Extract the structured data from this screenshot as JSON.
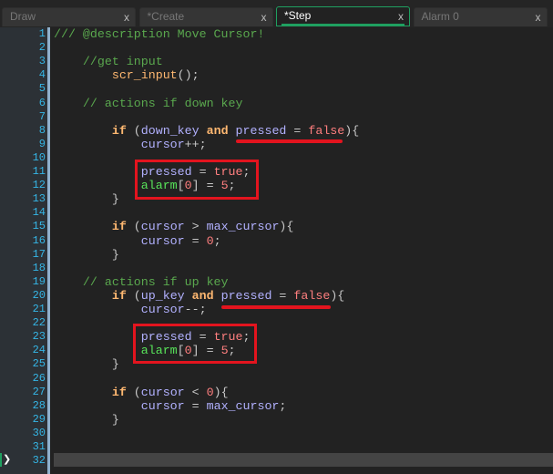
{
  "tabs": [
    {
      "label": "Draw",
      "close": "x",
      "active": false
    },
    {
      "label": "*Create",
      "close": "x",
      "active": false
    },
    {
      "label": "*Step",
      "close": "x",
      "active": true
    },
    {
      "label": "Alarm 0",
      "close": "x",
      "active": false
    }
  ],
  "colors": {
    "accent": "#1fa060",
    "annotation": "#e3141e",
    "comment": "#5aa84e",
    "keyword": "#ffb871",
    "variable": "#b2b1ff",
    "literal": "#ff7f7f",
    "builtin": "#58e55a"
  },
  "editor": {
    "current_line": 32,
    "lines": [
      [
        [
          "comment",
          "/// @description Move Cursor!"
        ]
      ],
      [],
      [
        [
          "comment",
          "    //get input"
        ]
      ],
      [
        [
          "punc",
          "        "
        ],
        [
          "fn",
          "scr_input"
        ],
        [
          "punc",
          "();"
        ]
      ],
      [],
      [
        [
          "comment",
          "    // actions if down key"
        ]
      ],
      [],
      [
        [
          "punc",
          "        "
        ],
        [
          "kw",
          "if"
        ],
        [
          "punc",
          " ("
        ],
        [
          "var",
          "down_key"
        ],
        [
          "punc",
          " "
        ],
        [
          "kw",
          "and"
        ],
        [
          "punc",
          " "
        ],
        [
          "var",
          "pressed"
        ],
        [
          "punc",
          " = "
        ],
        [
          "lit",
          "false"
        ],
        [
          "punc",
          "){"
        ]
      ],
      [
        [
          "punc",
          "            "
        ],
        [
          "var",
          "cursor"
        ],
        [
          "punc",
          "++;"
        ]
      ],
      [],
      [
        [
          "punc",
          "            "
        ],
        [
          "var",
          "pressed"
        ],
        [
          "punc",
          " = "
        ],
        [
          "lit",
          "true"
        ],
        [
          "punc",
          ";"
        ]
      ],
      [
        [
          "punc",
          "            "
        ],
        [
          "builtin",
          "alarm"
        ],
        [
          "punc",
          "["
        ],
        [
          "lit",
          "0"
        ],
        [
          "punc",
          "] = "
        ],
        [
          "lit",
          "5"
        ],
        [
          "punc",
          ";"
        ]
      ],
      [
        [
          "punc",
          "        }"
        ]
      ],
      [],
      [
        [
          "punc",
          "        "
        ],
        [
          "kw",
          "if"
        ],
        [
          "punc",
          " ("
        ],
        [
          "var",
          "cursor"
        ],
        [
          "punc",
          " > "
        ],
        [
          "var",
          "max_cursor"
        ],
        [
          "punc",
          "){"
        ]
      ],
      [
        [
          "punc",
          "            "
        ],
        [
          "var",
          "cursor"
        ],
        [
          "punc",
          " = "
        ],
        [
          "lit",
          "0"
        ],
        [
          "punc",
          ";"
        ]
      ],
      [
        [
          "punc",
          "        }"
        ]
      ],
      [],
      [
        [
          "comment",
          "    // actions if up key"
        ]
      ],
      [
        [
          "punc",
          "        "
        ],
        [
          "kw",
          "if"
        ],
        [
          "punc",
          " ("
        ],
        [
          "var",
          "up_key"
        ],
        [
          "punc",
          " "
        ],
        [
          "kw",
          "and"
        ],
        [
          "punc",
          " "
        ],
        [
          "var",
          "pressed"
        ],
        [
          "punc",
          " = "
        ],
        [
          "lit",
          "false"
        ],
        [
          "punc",
          "){"
        ]
      ],
      [
        [
          "punc",
          "            "
        ],
        [
          "var",
          "cursor"
        ],
        [
          "punc",
          "--;"
        ]
      ],
      [],
      [
        [
          "punc",
          "            "
        ],
        [
          "var",
          "pressed"
        ],
        [
          "punc",
          " = "
        ],
        [
          "lit",
          "true"
        ],
        [
          "punc",
          ";"
        ]
      ],
      [
        [
          "punc",
          "            "
        ],
        [
          "builtin",
          "alarm"
        ],
        [
          "punc",
          "["
        ],
        [
          "lit",
          "0"
        ],
        [
          "punc",
          "] = "
        ],
        [
          "lit",
          "5"
        ],
        [
          "punc",
          ";"
        ]
      ],
      [
        [
          "punc",
          "        }"
        ]
      ],
      [],
      [
        [
          "punc",
          "        "
        ],
        [
          "kw",
          "if"
        ],
        [
          "punc",
          " ("
        ],
        [
          "var",
          "cursor"
        ],
        [
          "punc",
          " < "
        ],
        [
          "lit",
          "0"
        ],
        [
          "punc",
          "){"
        ]
      ],
      [
        [
          "punc",
          "            "
        ],
        [
          "var",
          "cursor"
        ],
        [
          "punc",
          " = "
        ],
        [
          "var",
          "max_cursor"
        ],
        [
          "punc",
          ";"
        ]
      ],
      [
        [
          "punc",
          "        }"
        ]
      ],
      [],
      [],
      []
    ]
  }
}
